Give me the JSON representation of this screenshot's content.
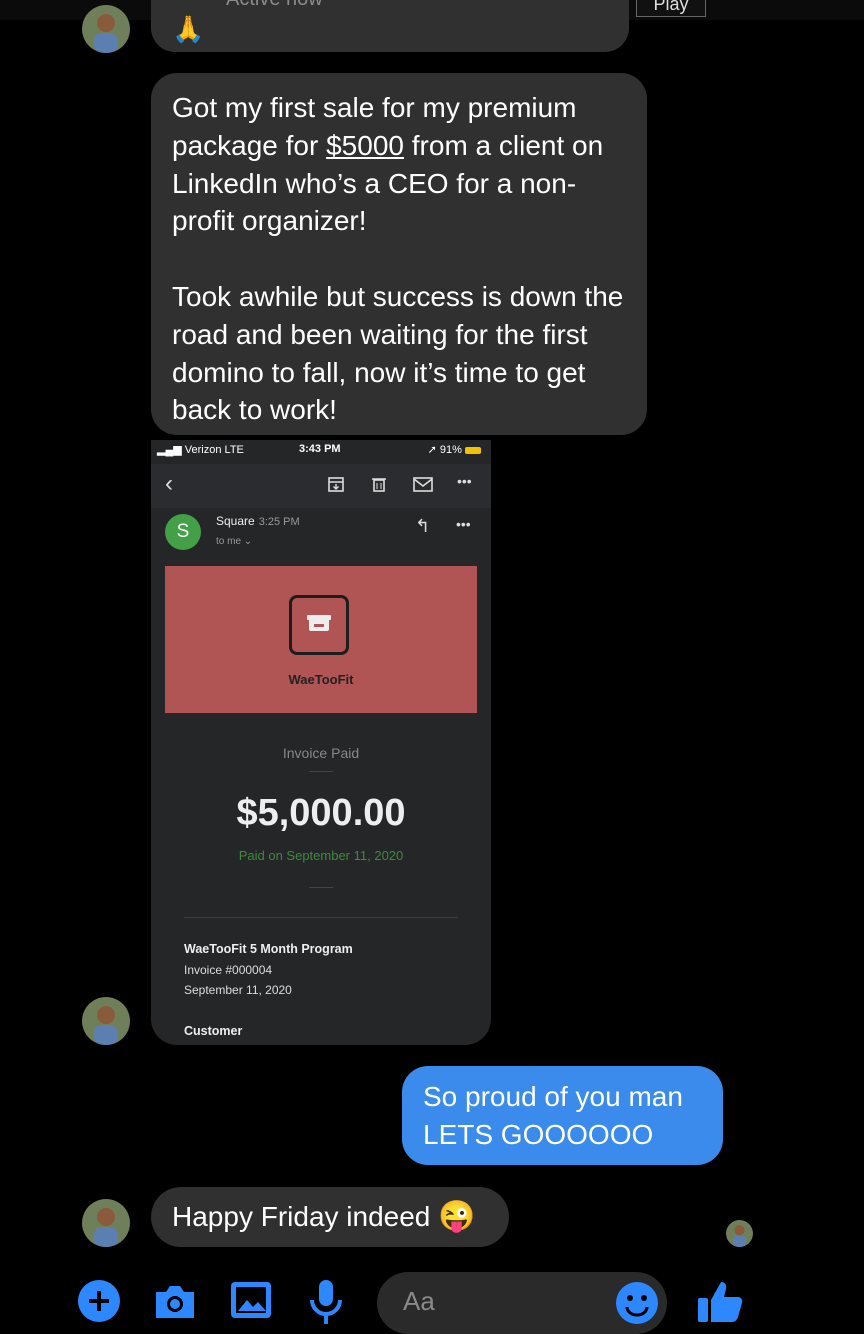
{
  "header": {
    "status": "Active now",
    "play_label": "Play"
  },
  "messages": {
    "first_sale": {
      "p1_a": "Got my first sale for my premium package for ",
      "p1_amount": "$5000",
      "p1_b": " from a client on LinkedIn who’s a CEO for a non-profit organizer!",
      "p2": "Took awhile but success is down the road and been waiting for the first domino to fall, now it’s time to get back to work!"
    },
    "sent": {
      "line1": "So proud of you man",
      "line2": "LETS GOOOOOO"
    },
    "reply": {
      "text": "Happy Friday indeed",
      "emoji": "😜"
    }
  },
  "screenshot": {
    "status_bar": {
      "carrier": "Verizon  LTE",
      "time": "3:43 PM",
      "battery": "91%"
    },
    "email": {
      "sender_initial": "S",
      "sender": "Square",
      "time": "3:25 PM",
      "to": "to me",
      "brand": "WaeTooFit",
      "invoice_status": "Invoice Paid",
      "amount": "$5,000.00",
      "paid_on": "Paid on September 11, 2020",
      "program": "WaeTooFit 5 Month Program",
      "invoice_no": "Invoice #000004",
      "invoice_date": "September 11, 2020",
      "customer_label": "Customer"
    }
  },
  "composer": {
    "placeholder": "Aa"
  },
  "colors": {
    "sent_bubble": "#3b8bed",
    "received_bubble": "#303030",
    "accent": "#2d88ff",
    "banner": "#b05454"
  }
}
